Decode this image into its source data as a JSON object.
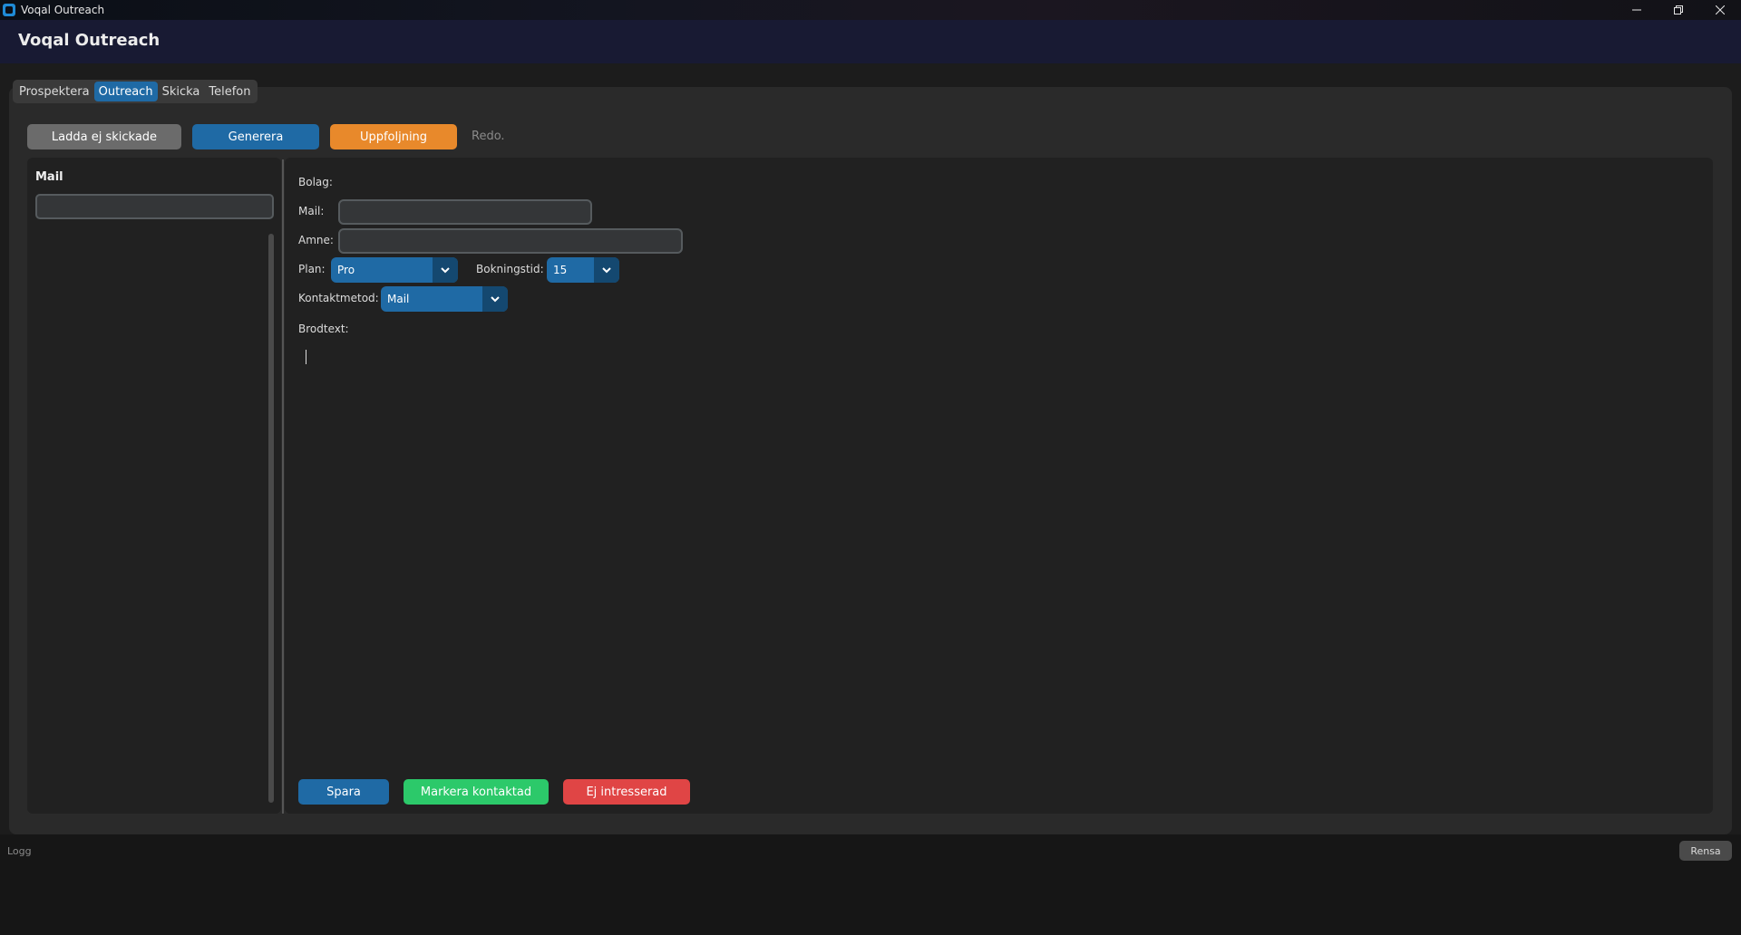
{
  "window": {
    "title": "Voqal Outreach",
    "icons": {
      "app": "app-icon",
      "minimize": "minimize-icon",
      "maximize": "restore-icon",
      "close": "close-icon"
    }
  },
  "header": {
    "title": "Voqal Outreach"
  },
  "tabs": [
    {
      "label": "Prospektera",
      "active": false
    },
    {
      "label": "Outreach",
      "active": true
    },
    {
      "label": "Skicka",
      "active": false
    },
    {
      "label": "Telefon",
      "active": false
    }
  ],
  "toolbar": {
    "load_unsent_label": "Ladda ej skickade",
    "generate_label": "Generera",
    "followup_label": "Uppfoljning",
    "status_text": "Redo."
  },
  "list_panel": {
    "title": "Mail",
    "search_value": ""
  },
  "form": {
    "company_label": "Bolag:",
    "company_value": "",
    "mail_label": "Mail:",
    "mail_value": "",
    "subject_label": "Amne:",
    "subject_value": "",
    "plan_label": "Plan:",
    "plan_value": "Pro",
    "booking_label": "Bokningstid:",
    "booking_value": "15",
    "contact_method_label": "Kontaktmetod:",
    "contact_method_value": "Mail",
    "body_label": "Brodtext:",
    "body_value": ""
  },
  "actions": {
    "save_label": "Spara",
    "mark_contacted_label": "Markera kontaktad",
    "not_interested_label": "Ej intresserad"
  },
  "log": {
    "label": "Logg",
    "clear_label": "Rensa"
  },
  "colors": {
    "accent_blue": "#1f6aa5",
    "orange": "#e8892b",
    "green": "#2cc96a",
    "red": "#e04545",
    "header_bg": "#181a33"
  }
}
